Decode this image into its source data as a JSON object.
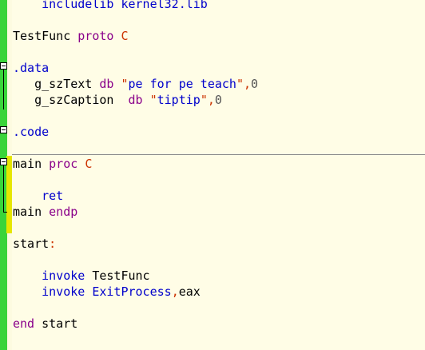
{
  "editor": {
    "lines": [
      {
        "indent": "    ",
        "tokens": [
          {
            "t": "includelib kernel32.lib",
            "c": "dir"
          }
        ]
      },
      {
        "indent": "",
        "tokens": []
      },
      {
        "indent": "",
        "tokens": [
          {
            "t": "TestFunc ",
            "c": ""
          },
          {
            "t": "proto ",
            "c": "kw"
          },
          {
            "t": "C",
            "c": "pun"
          }
        ]
      },
      {
        "indent": "",
        "tokens": []
      },
      {
        "indent": "",
        "tokens": [
          {
            "t": ".data",
            "c": "dir"
          }
        ]
      },
      {
        "indent": "   ",
        "tokens": [
          {
            "t": "g_szText ",
            "c": ""
          },
          {
            "t": "db ",
            "c": "kw"
          },
          {
            "t": "\"",
            "c": "pun"
          },
          {
            "t": "pe for pe teach",
            "c": "dir"
          },
          {
            "t": "\"",
            "c": "pun"
          },
          {
            "t": ",",
            "c": "pun"
          },
          {
            "t": "0",
            "c": "num"
          }
        ]
      },
      {
        "indent": "   ",
        "tokens": [
          {
            "t": "g_szCaption  ",
            "c": ""
          },
          {
            "t": "db ",
            "c": "kw"
          },
          {
            "t": "\"",
            "c": "pun"
          },
          {
            "t": "tiptip",
            "c": "dir"
          },
          {
            "t": "\"",
            "c": "pun"
          },
          {
            "t": ",",
            "c": "pun"
          },
          {
            "t": "0",
            "c": "num"
          }
        ]
      },
      {
        "indent": "",
        "tokens": []
      },
      {
        "indent": "",
        "tokens": [
          {
            "t": ".code",
            "c": "dir"
          }
        ]
      },
      {
        "indent": "",
        "tokens": []
      },
      {
        "indent": "",
        "tokens": [
          {
            "t": "main ",
            "c": ""
          },
          {
            "t": "proc ",
            "c": "kw"
          },
          {
            "t": "C",
            "c": "pun"
          }
        ]
      },
      {
        "indent": "",
        "tokens": []
      },
      {
        "indent": "    ",
        "tokens": [
          {
            "t": "ret",
            "c": "dir"
          }
        ]
      },
      {
        "indent": "",
        "tokens": [
          {
            "t": "main ",
            "c": ""
          },
          {
            "t": "endp",
            "c": "kw"
          }
        ]
      },
      {
        "indent": "",
        "tokens": []
      },
      {
        "indent": "",
        "tokens": [
          {
            "t": "start",
            "c": ""
          },
          {
            "t": ":",
            "c": "pun"
          }
        ]
      },
      {
        "indent": "",
        "tokens": []
      },
      {
        "indent": "    ",
        "tokens": [
          {
            "t": "invoke ",
            "c": "dir"
          },
          {
            "t": "TestFunc",
            "c": ""
          }
        ]
      },
      {
        "indent": "    ",
        "tokens": [
          {
            "t": "invoke ",
            "c": "dir"
          },
          {
            "t": "ExitProcess",
            "c": "dir"
          },
          {
            "t": ",",
            "c": "pun"
          },
          {
            "t": "eax",
            "c": ""
          }
        ]
      },
      {
        "indent": "",
        "tokens": []
      },
      {
        "indent": "",
        "tokens": [
          {
            "t": "end ",
            "c": "kw"
          },
          {
            "t": "start",
            "c": ""
          }
        ]
      }
    ]
  },
  "colors": {
    "gutter": "#3ad43a",
    "background": "#fffde6",
    "change_bar": "#e6e600"
  }
}
